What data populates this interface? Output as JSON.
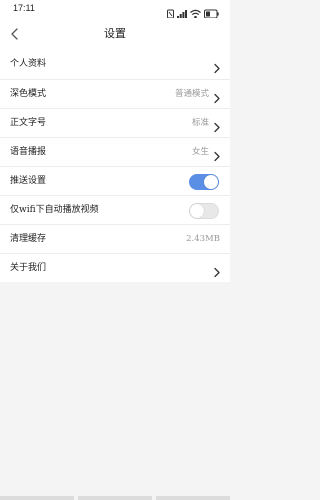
{
  "status_bar": {
    "time": "17:11",
    "battery_text": "33"
  },
  "header": {
    "title": "设置"
  },
  "settings": {
    "items": [
      {
        "label": "个人资料",
        "value": ""
      },
      {
        "label": "深色模式",
        "value": "普通模式"
      },
      {
        "label": "正文字号",
        "value": "标准"
      },
      {
        "label": "语音播报",
        "value": "女生"
      },
      {
        "label": "推送设置",
        "toggle": "on"
      },
      {
        "label": "仅wifi下自动播放视频",
        "toggle": "off"
      },
      {
        "label": "清理缓存",
        "value": "2.43MB"
      },
      {
        "label": "关于我们",
        "value": ""
      }
    ]
  },
  "colors": {
    "accent": "#5b8fe6",
    "background": "#f4f4f4"
  },
  "icons": [
    "back-arrow-icon",
    "chevron-right-icon",
    "signal-icon",
    "wifi-icon",
    "battery-icon"
  ]
}
